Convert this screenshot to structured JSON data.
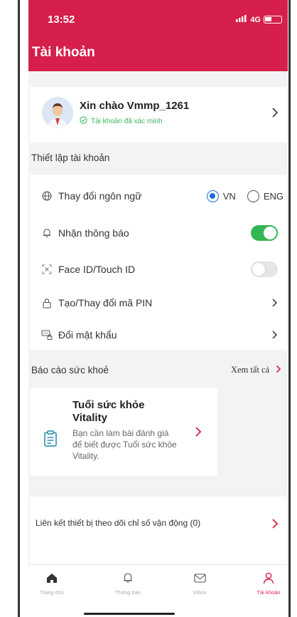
{
  "status_bar": {
    "time": "13:52",
    "network": "4G"
  },
  "header": {
    "title": "Tài khoản"
  },
  "profile": {
    "greeting": "Xin chào Vmmp_1261",
    "verified_text": "Tài khoản đã xác minh"
  },
  "account_settings": {
    "section_title": "Thiết lập tài khoản",
    "language": {
      "label": "Thay đổi ngôn ngữ",
      "options": [
        "VN",
        "ENG"
      ],
      "selected": "VN"
    },
    "notifications": {
      "label": "Nhận thông báo",
      "enabled": true
    },
    "face_id": {
      "label": "Face ID/Touch ID",
      "enabled": false
    },
    "pin": {
      "label": "Tạo/Thay đổi mã PIN"
    },
    "password": {
      "label": "Đổi mật khẩu"
    }
  },
  "health_report": {
    "section_title": "Báo cáo sức khoẻ",
    "see_all": "Xem tất cả",
    "vitality": {
      "title": "Tuổi sức khỏe Vitality",
      "description": "Bạn cần làm bài đánh giá để biết được Tuổi sức khỏe Vitality."
    }
  },
  "device_link": {
    "label": "Liên kết thiết bị theo dõi chỉ số vận động (0)"
  },
  "bottom_nav": {
    "items": [
      {
        "label": "Trang chủ",
        "icon": "home-icon"
      },
      {
        "label": "Thông báo",
        "icon": "bell-icon"
      },
      {
        "label": "Inbox",
        "icon": "mail-icon"
      },
      {
        "label": "Tài khoản",
        "icon": "person-icon"
      }
    ],
    "active": "Tài khoản"
  },
  "colors": {
    "brand": "#d61f4a",
    "toggle_on": "#33b653",
    "radio_selected": "#1d6fd6",
    "verified": "#3bb35c"
  }
}
